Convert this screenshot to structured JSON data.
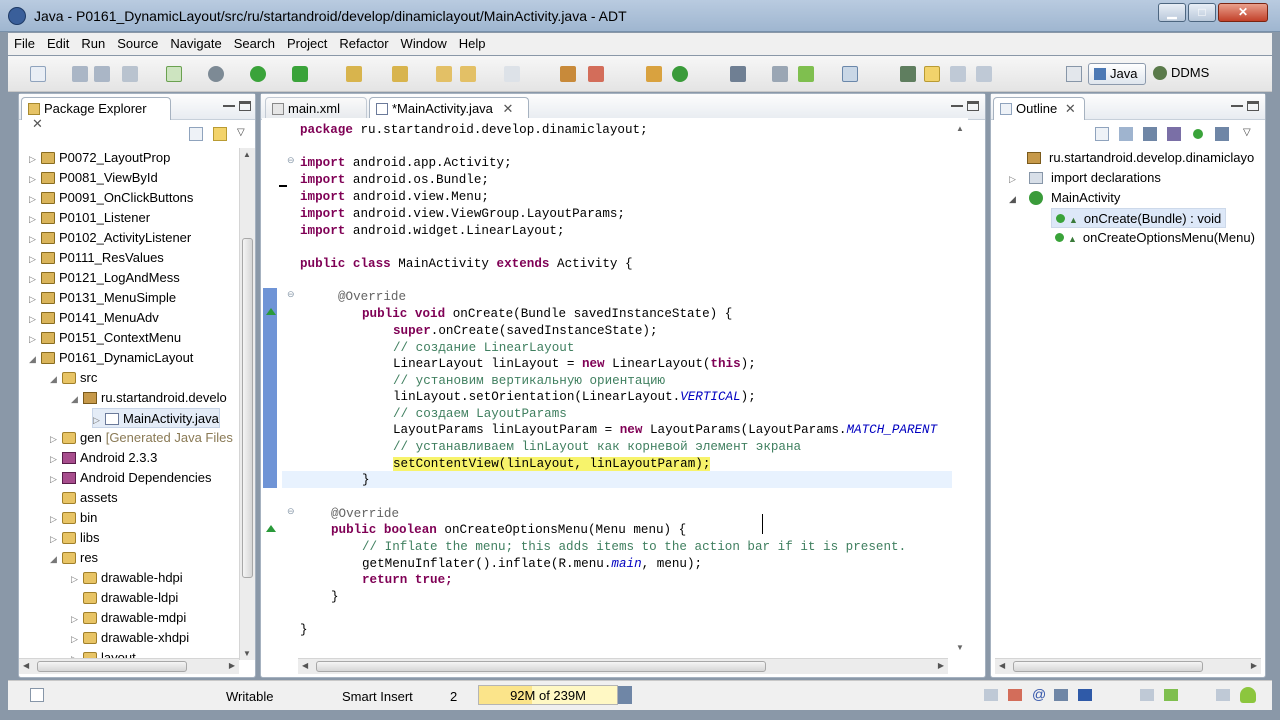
{
  "window": {
    "title": "Java - P0161_DynamicLayout/src/ru/startandroid/develop/dinamiclayout/MainActivity.java - ADT"
  },
  "menu": [
    "File",
    "Edit",
    "Run",
    "Source",
    "Navigate",
    "Search",
    "Project",
    "Refactor",
    "Window",
    "Help"
  ],
  "perspectives": {
    "java": "Java",
    "ddms": "DDMS"
  },
  "package_explorer": {
    "title": "Package Explorer",
    "items": [
      {
        "label": "P0072_LayoutProp"
      },
      {
        "label": "P0081_ViewById"
      },
      {
        "label": "P0091_OnClickButtons"
      },
      {
        "label": "P0101_Listener"
      },
      {
        "label": "P0102_ActivityListener"
      },
      {
        "label": "P0111_ResValues"
      },
      {
        "label": "P0121_LogAndMess"
      },
      {
        "label": "P0131_MenuSimple"
      },
      {
        "label": "P0141_MenuAdv"
      },
      {
        "label": "P0151_ContextMenu"
      },
      {
        "label": "P0161_DynamicLayout"
      },
      {
        "label": "src"
      },
      {
        "label": "ru.startandroid.develo"
      },
      {
        "label": "MainActivity.java"
      },
      {
        "label": "gen",
        "decor": "[Generated Java Files"
      },
      {
        "label": "Android 2.3.3"
      },
      {
        "label": "Android Dependencies"
      },
      {
        "label": "assets"
      },
      {
        "label": "bin"
      },
      {
        "label": "libs"
      },
      {
        "label": "res"
      },
      {
        "label": "drawable-hdpi"
      },
      {
        "label": "drawable-ldpi"
      },
      {
        "label": "drawable-mdpi"
      },
      {
        "label": "drawable-xhdpi"
      },
      {
        "label": "layout"
      }
    ]
  },
  "editor_tabs": [
    {
      "label": "main.xml"
    },
    {
      "label": "*MainActivity.java"
    }
  ],
  "code": {
    "l1": "ru.startandroid.develop.dinamiclayout;",
    "i1": "android.app.Activity;",
    "i2": "android.os.Bundle;",
    "i3": "android.view.Menu;",
    "i4": "android.view.ViewGroup.LayoutParams;",
    "i5": "android.widget.LinearLayout;",
    "cls": "MainActivity",
    "ext_cls": "Activity {",
    "override": "@Override",
    "oncreate": "onCreate(Bundle savedInstanceState) {",
    "super_call": ".onCreate(savedInstanceState);",
    "c1": "// создание LinearLayout",
    "ll_decl": "LinearLayout linLayout = ",
    "ll_new": " LinearLayout(",
    "ll_this": "this",
    "ll_end": ");",
    "c2": "// установим вертикальную ориентацию",
    "set_orient": "linLayout.setOrientation(LinearLayout.",
    "vertical": "VERTICAL",
    "c3": "// создаем LayoutParams",
    "lp_decl": "LayoutParams linLayoutParam = ",
    "lp_new": " LayoutParams(LayoutParams.",
    "match_parent": "MATCH_PARENT",
    "c4": "// устанавливаем linLayout как корневой элемент экрана",
    "set_content": "setContentView(linLayout, linLayoutParam);",
    "close_brace": "}",
    "oncreateopts": "onCreateOptionsMenu(Menu menu) {",
    "c5": "// Inflate the menu; this adds items to the action bar if it is present.",
    "inflate1": "getMenuInflater().inflate(R.menu.",
    "main": "main",
    "inflate2": ", menu);",
    "ret_val": "true;"
  },
  "outline": {
    "title": "Outline",
    "items": [
      {
        "label": "ru.startandroid.develop.dinamiclayo"
      },
      {
        "label": "import declarations"
      },
      {
        "label": "MainActivity"
      },
      {
        "label": "onCreate(Bundle) : void"
      },
      {
        "label": "onCreateOptionsMenu(Menu)"
      }
    ]
  },
  "status": {
    "writable": "Writable",
    "insert": "Smart Insert",
    "position": "2",
    "heap": "92M of 239M",
    "heap_used_fraction": 0.385
  }
}
